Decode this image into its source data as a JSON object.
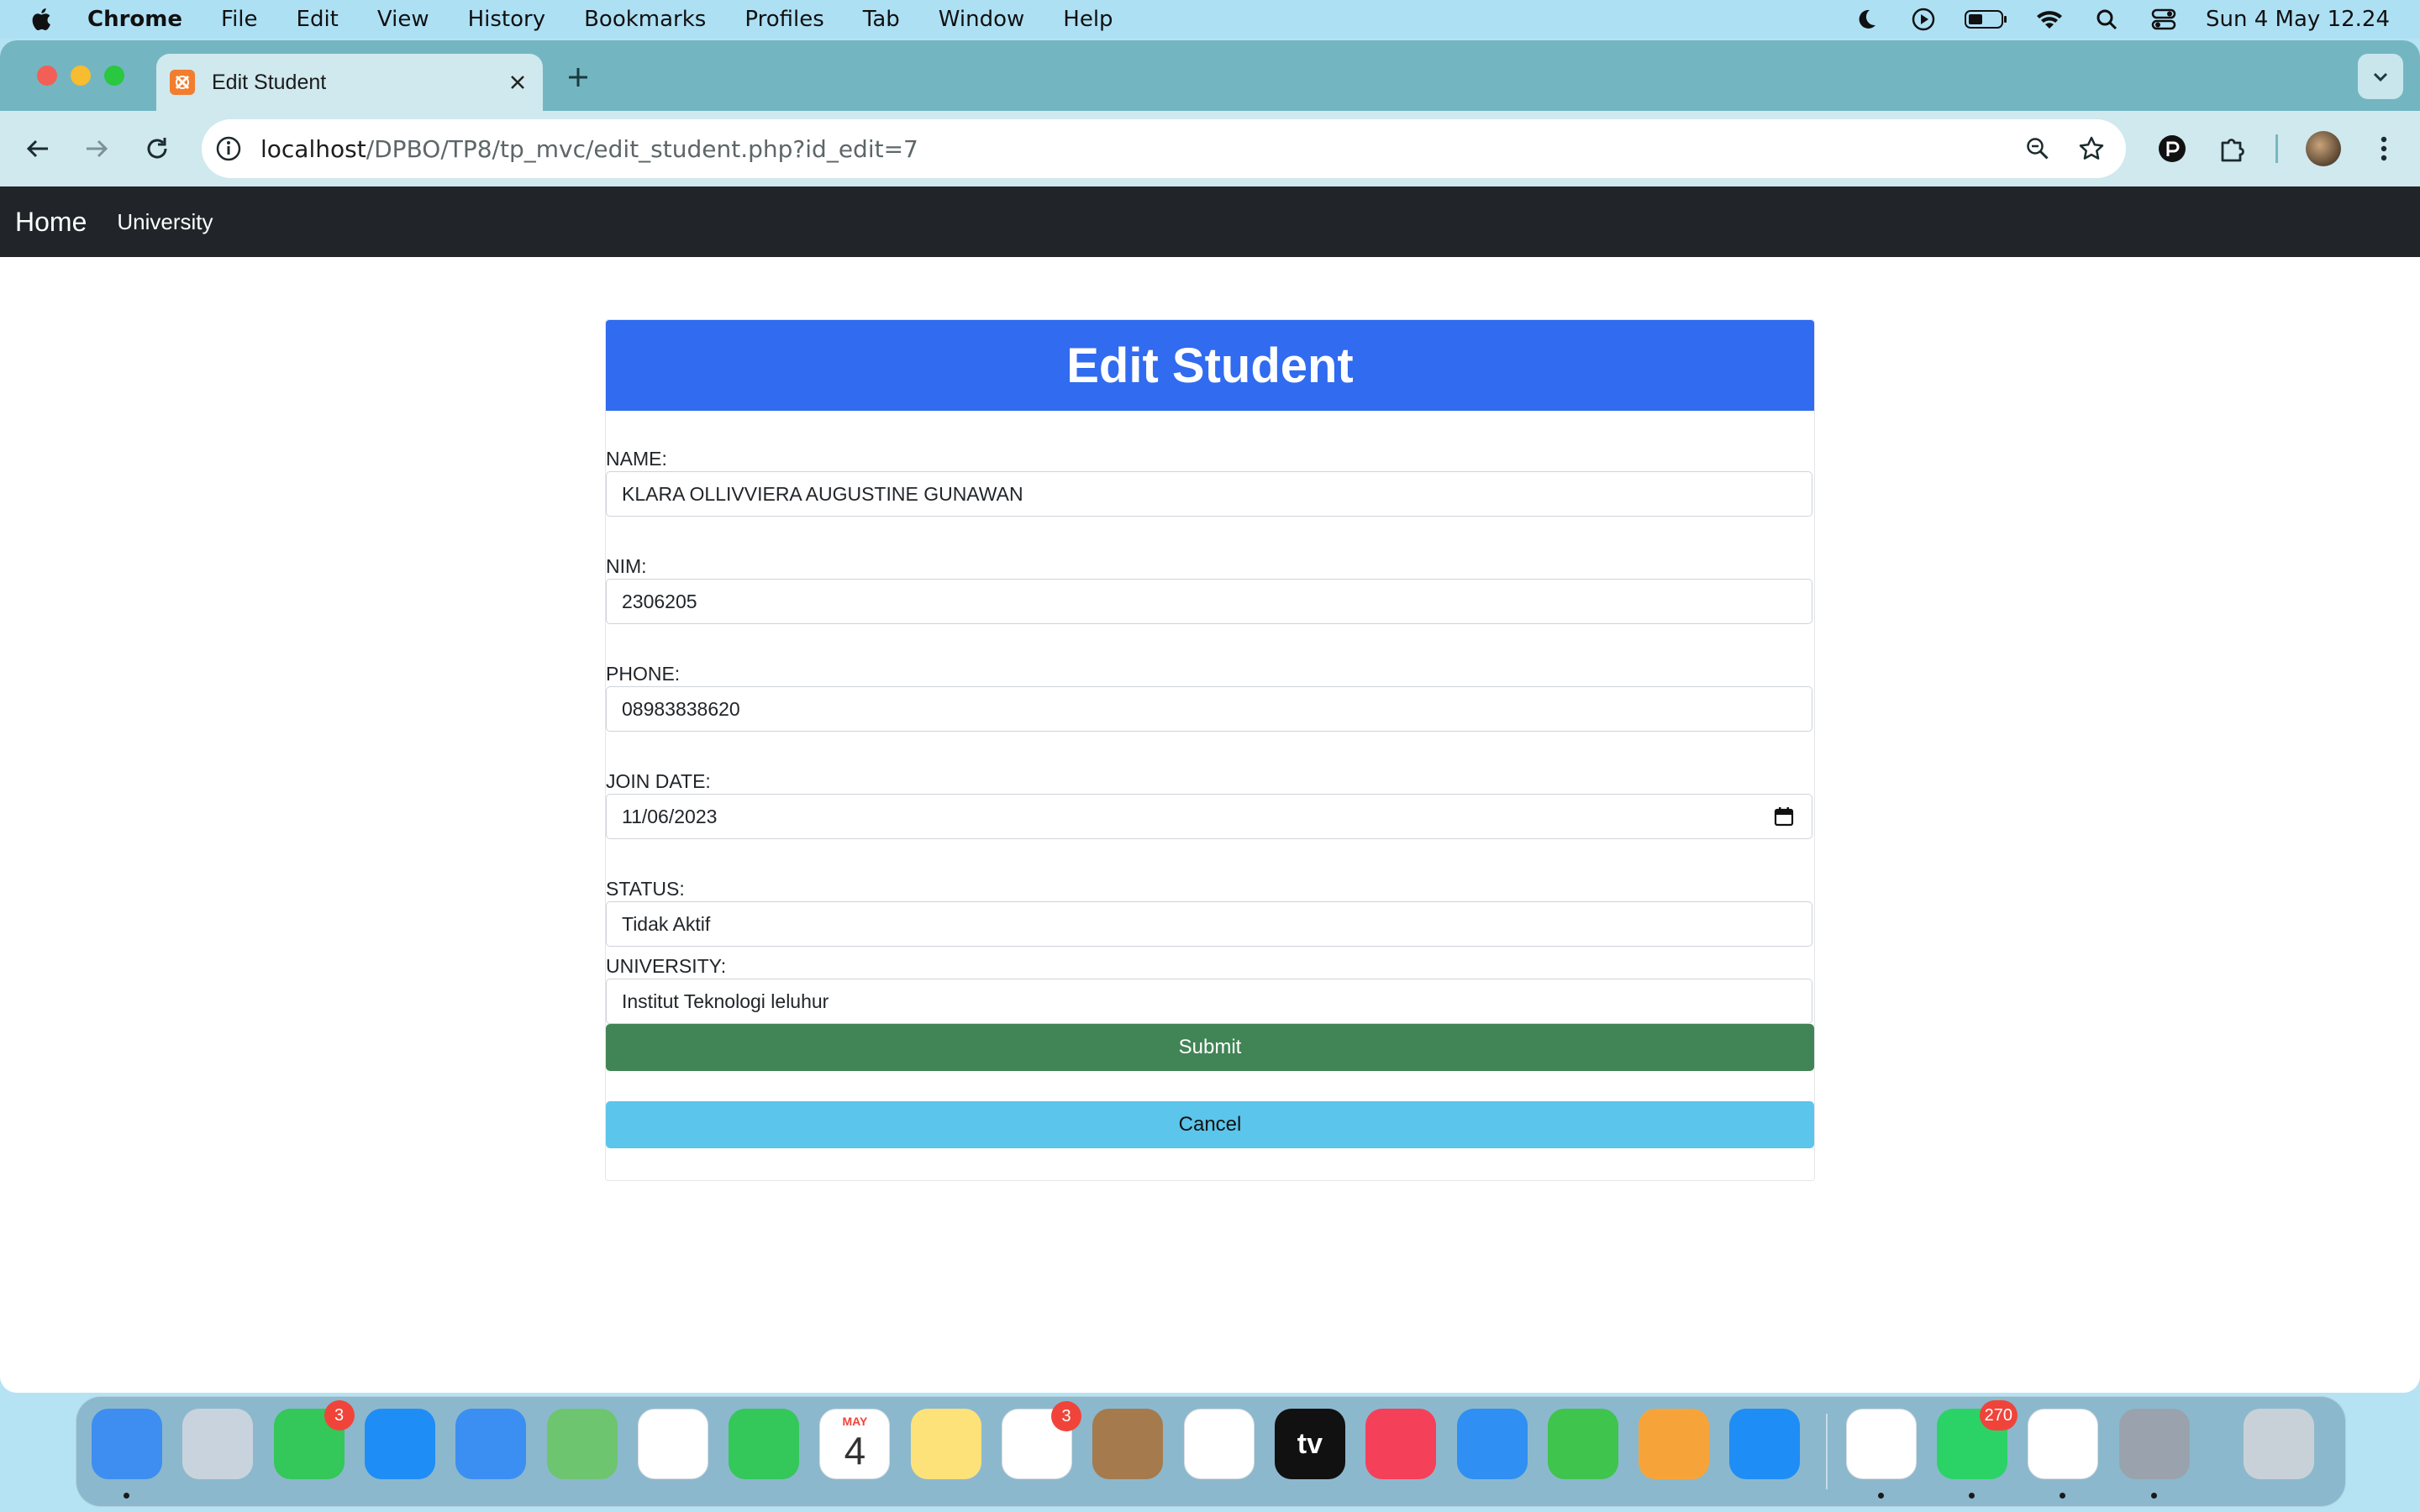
{
  "menubar": {
    "items": [
      "Chrome",
      "File",
      "Edit",
      "View",
      "History",
      "Bookmarks",
      "Profiles",
      "Tab",
      "Window",
      "Help"
    ],
    "status_icons": [
      "moon-icon",
      "play-circle-icon",
      "battery-icon",
      "wifi-icon",
      "search-icon",
      "control-center-icon"
    ],
    "clock": "Sun 4 May  12.24"
  },
  "browser": {
    "tab_title": "Edit Student",
    "url_host": "localhost",
    "url_path": "/DPBO/TP8/tp_mvc/edit_student.php?id_edit=7"
  },
  "site_nav": {
    "brand": "Home",
    "link": "University"
  },
  "form": {
    "heading": "Edit Student",
    "fields": {
      "name": {
        "label": "NAME:",
        "value": "KLARA OLLIVVIERA AUGUSTINE GUNAWAN"
      },
      "nim": {
        "label": "NIM:",
        "value": "2306205"
      },
      "phone": {
        "label": "PHONE:",
        "value": "08983838620"
      },
      "join_date": {
        "label": "JOIN DATE:",
        "value": "11/06/2023"
      },
      "status": {
        "label": "STATUS:",
        "value": "Tidak Aktif"
      },
      "university": {
        "label": "UNIVERSITY:",
        "value": "Institut Teknologi leluhur"
      }
    },
    "submit_label": "Submit",
    "cancel_label": "Cancel"
  },
  "dock": {
    "apps": [
      {
        "name": "finder",
        "color": "#3d8ef0"
      },
      {
        "name": "launchpad",
        "color": "#c9d3de"
      },
      {
        "name": "messages",
        "color": "#34c759",
        "badge": "3"
      },
      {
        "name": "safari",
        "color": "#1e8ef6"
      },
      {
        "name": "mail",
        "color": "#3b8ff2"
      },
      {
        "name": "maps",
        "color": "#6ec56f"
      },
      {
        "name": "photos",
        "color": "#ffffff"
      },
      {
        "name": "facetime",
        "color": "#34c759"
      },
      {
        "name": "calendar",
        "color": "#ffffff",
        "month": "MAY",
        "day": "4"
      },
      {
        "name": "notes",
        "color": "#fde27a"
      },
      {
        "name": "reminders",
        "color": "#ffffff",
        "badge": "3"
      },
      {
        "name": "contacts",
        "color": "#a57a4d"
      },
      {
        "name": "freeform",
        "color": "#ffffff"
      },
      {
        "name": "apple-tv",
        "color": "#111111",
        "label": "tv"
      },
      {
        "name": "music",
        "color": "#f5405a"
      },
      {
        "name": "keynote",
        "color": "#2f8ff2"
      },
      {
        "name": "numbers",
        "color": "#3fc44e"
      },
      {
        "name": "pages",
        "color": "#f6a43a"
      },
      {
        "name": "app-store",
        "color": "#1e8ef6"
      },
      {
        "name": "chrome",
        "color": "#ffffff"
      },
      {
        "name": "whatsapp",
        "color": "#2bd366",
        "badge": "270"
      },
      {
        "name": "vscode",
        "color": "#ffffff"
      },
      {
        "name": "system-settings",
        "color": "#9aa3ad"
      },
      {
        "name": "trash",
        "color": "#c9d1d8"
      }
    ]
  }
}
